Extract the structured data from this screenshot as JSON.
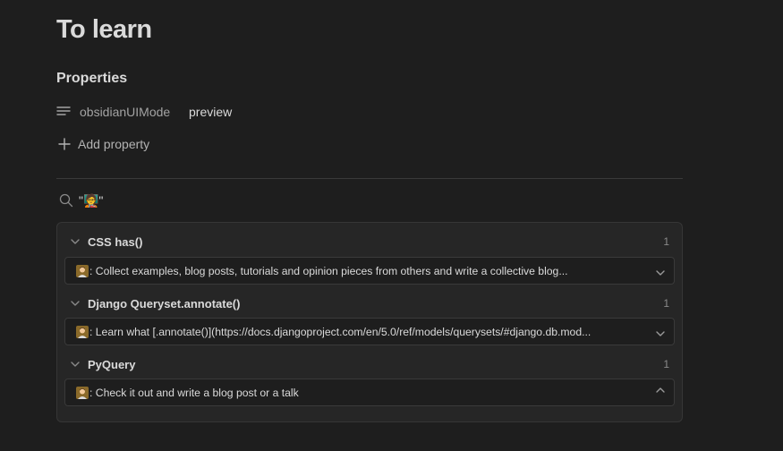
{
  "page": {
    "title": "To learn"
  },
  "properties": {
    "heading": "Properties",
    "items": [
      {
        "icon": "text-lines-icon",
        "key": "obsidianUIMode",
        "value": "preview"
      }
    ],
    "add_label": "Add property"
  },
  "search": {
    "query": "\"🧑‍🏫\""
  },
  "results": {
    "groups": [
      {
        "title": "CSS has()",
        "count": "1",
        "match_emoji": "🧑‍🏫",
        "match_text": ": Collect examples, blog posts, tutorials and opinion pieces from others and write a collective blog...",
        "expand_icon": "chevron-down-icon"
      },
      {
        "title": "Django Queryset.annotate()",
        "count": "1",
        "match_emoji": "🧑‍🏫",
        "match_text": ": Learn what [.annotate()](https://docs.djangoproject.com/en/5.0/ref/models/querysets/#django.db.mod...",
        "expand_icon": "chevron-down-icon"
      },
      {
        "title": "PyQuery",
        "count": "1",
        "match_emoji": "🧑‍🏫",
        "match_text": ": Check it out and write a blog post or a talk",
        "expand_icon": "chevron-up-icon"
      }
    ]
  },
  "colors": {
    "background": "#1e1e1e",
    "panel": "#262626",
    "text": "#dadada",
    "muted": "#a3a3a3",
    "border": "#363636"
  }
}
